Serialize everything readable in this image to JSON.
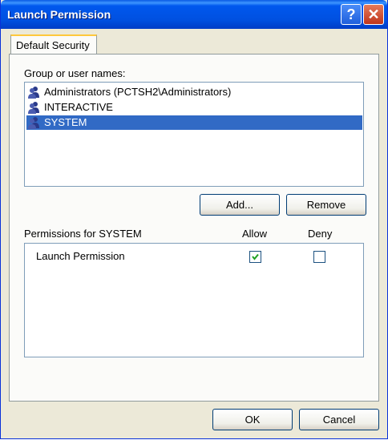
{
  "window": {
    "title": "Launch Permission"
  },
  "tabs": [
    {
      "label": "Default Security"
    }
  ],
  "groups": {
    "label": "Group or user names:",
    "items": [
      {
        "label": "Administrators (PCTSH2\\Administrators)",
        "icon": "user-group-icon",
        "selected": false
      },
      {
        "label": "INTERACTIVE",
        "icon": "user-group-icon",
        "selected": false
      },
      {
        "label": "SYSTEM",
        "icon": "user-group-icon",
        "selected": true
      }
    ],
    "add_label": "Add...",
    "remove_label": "Remove"
  },
  "permissions": {
    "label": "Permissions for SYSTEM",
    "allow_header": "Allow",
    "deny_header": "Deny",
    "rows": [
      {
        "label": "Launch Permission",
        "allow": true,
        "deny": false
      }
    ]
  },
  "footer": {
    "ok_label": "OK",
    "cancel_label": "Cancel"
  },
  "colors": {
    "selection": "#316ac5",
    "titlebar": "#0058ee",
    "check": "#21a121"
  }
}
